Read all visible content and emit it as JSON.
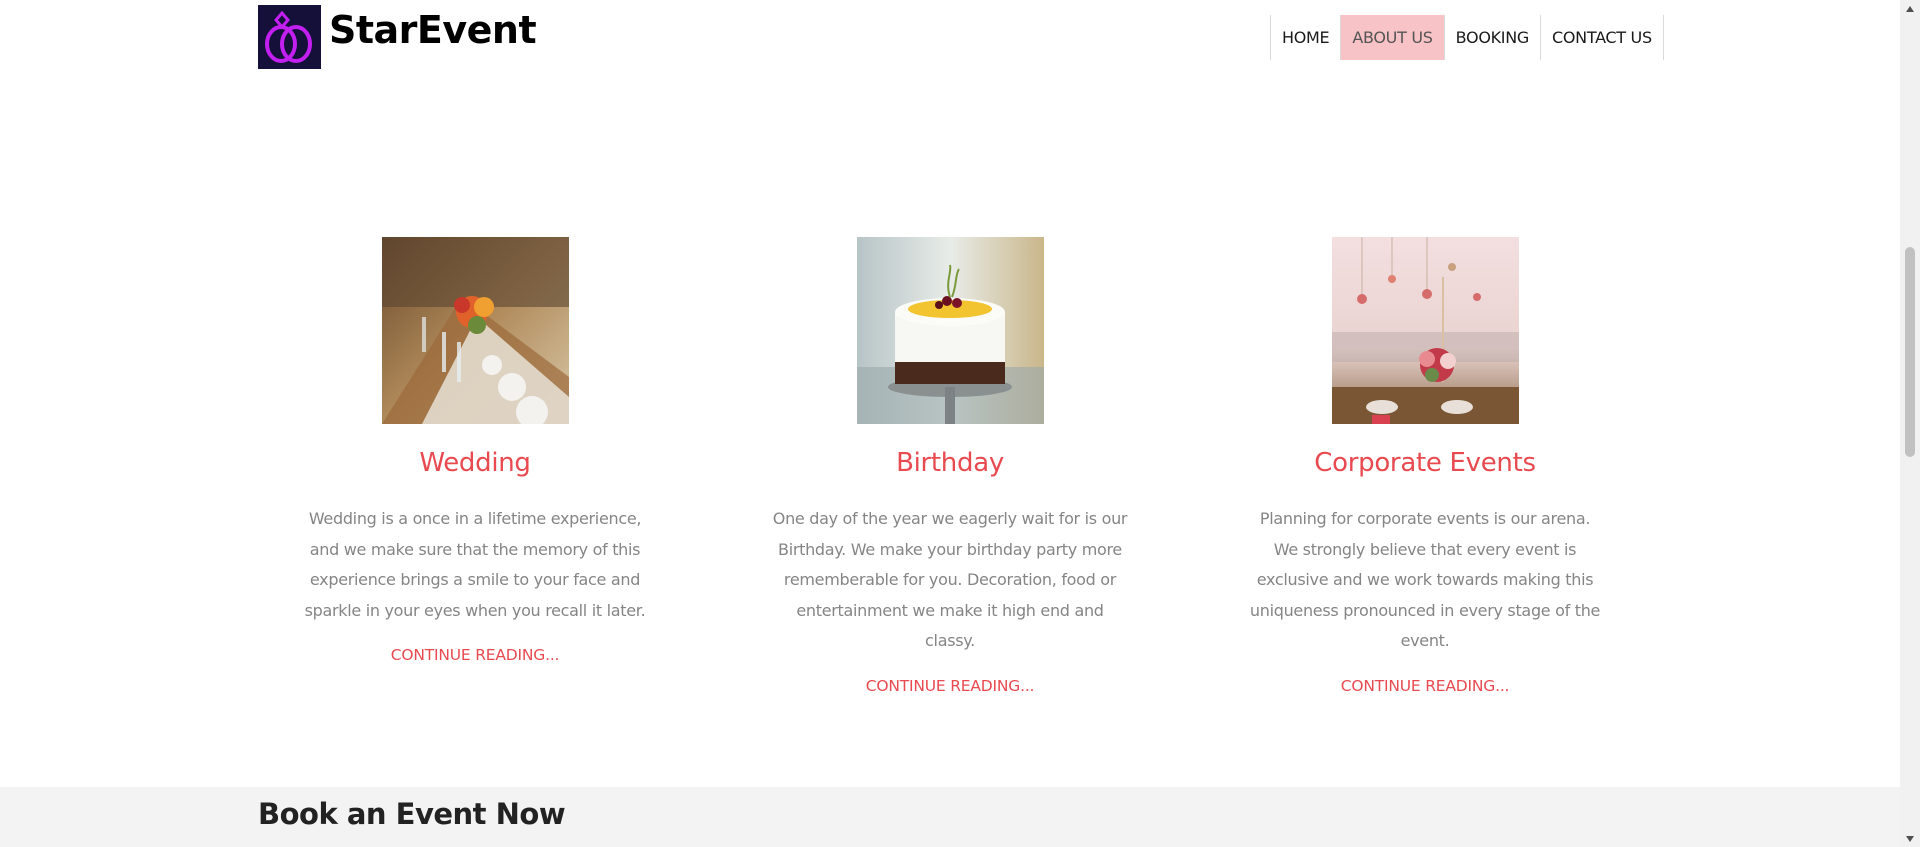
{
  "brand": {
    "name": "StarEvent"
  },
  "nav": {
    "items": [
      {
        "label": "HOME",
        "active": false
      },
      {
        "label": "ABOUT US",
        "active": true
      },
      {
        "label": "BOOKING",
        "active": false
      },
      {
        "label": "CONTACT US",
        "active": false
      }
    ]
  },
  "services": [
    {
      "title": "Wedding",
      "text": "Wedding is a once in a lifetime experience, and we make sure that the memory of this experience brings a smile to your face and sparkle in your eyes when you recall it later.",
      "link": "CONTINUE READING..."
    },
    {
      "title": "Birthday",
      "text": "One day of the year we eagerly wait for is our Birthday. We make your birthday party more rememberable for you. Decoration, food or entertainment we make it high end and classy.",
      "link": "CONTINUE READING..."
    },
    {
      "title": "Corporate Events",
      "text": "Planning for corporate events is our arena. We strongly believe that every event is exclusive and we work towards making this uniqueness pronounced in every stage of the event.",
      "link": "CONTINUE READING..."
    }
  ],
  "book": {
    "title": "Book an Event Now"
  },
  "colors": {
    "accent": "#e84a50",
    "nav_active": "#f8c3c6",
    "logo_bg": "#14103a",
    "logo_ring": "#c21ff0"
  },
  "icons": {
    "logo": "double-ring-icon",
    "scroll_up": "chevron-up-icon",
    "scroll_down": "chevron-down-icon"
  }
}
